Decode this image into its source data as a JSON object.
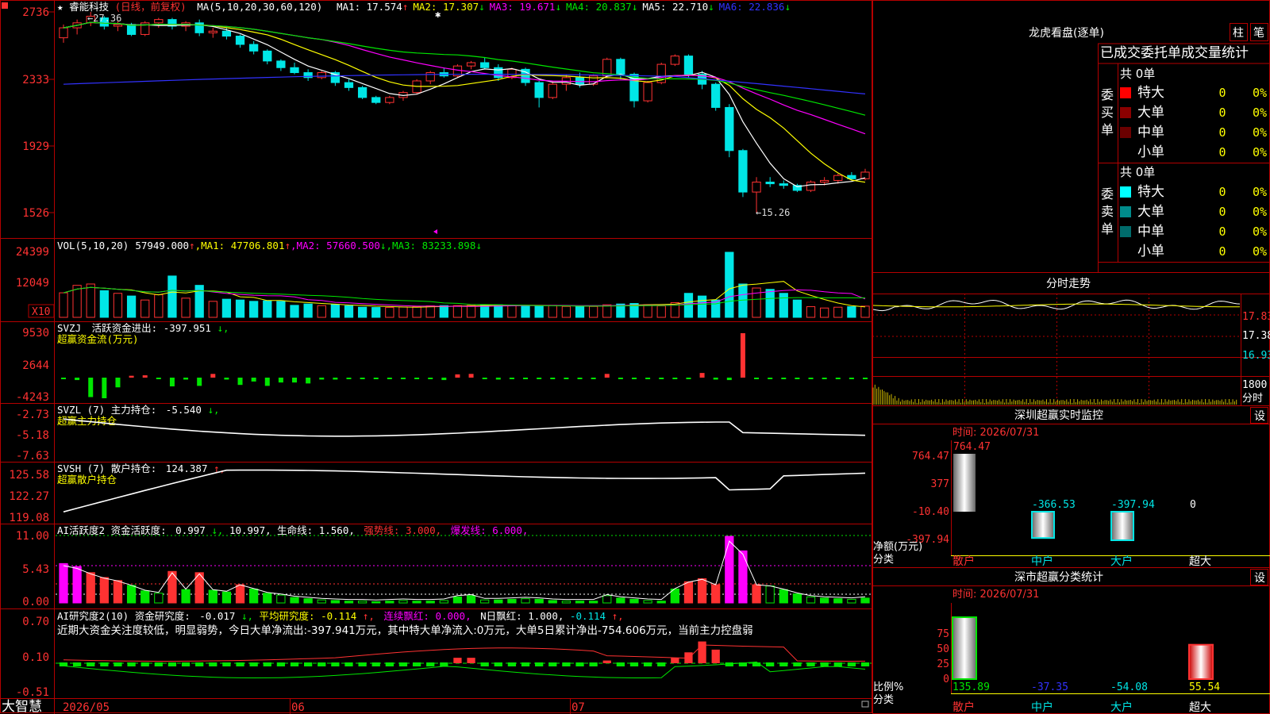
{
  "colors": {
    "up": "#ff3232",
    "down": "#00e6e6",
    "green_bar": "#00e600",
    "grid_red": "#b40000",
    "ma1": "#ffffff",
    "ma2": "#ffff00",
    "ma3": "#ff00ff",
    "ma4": "#00e600",
    "ma5": "#3232ff"
  },
  "top_corner_icon": "menu-square-icon",
  "stock": {
    "star": "★",
    "name": "睿能科技",
    "period": "(日线，前复权)",
    "ma_title": "MA(5,10,20,30,60,120)",
    "ma": [
      {
        "label": "MA1:",
        "value": "17.574",
        "arrow": "↑",
        "color": "#ffffff"
      },
      {
        "label": "MA2:",
        "value": "17.307",
        "arrow": "↓",
        "color": "#ffff00"
      },
      {
        "label": "MA3:",
        "value": "19.671",
        "arrow": "↓",
        "color": "#ff00ff"
      },
      {
        "label": "MA4:",
        "value": "20.837",
        "arrow": "↓",
        "color": "#00e600"
      },
      {
        "label": "MA5:",
        "value": "22.710",
        "arrow": "↓",
        "color": "#ffffff"
      },
      {
        "label": "MA6:",
        "value": "22.836",
        "arrow": "↓",
        "color": "#3232ff"
      }
    ],
    "high_label": "27.36",
    "low_label": "15.26",
    "y_ticks": [
      "2736",
      "2333",
      "1929",
      "1526"
    ]
  },
  "volume": {
    "title": "VOL(5,10,20)",
    "value": "57949.000",
    "arrow": "↑",
    "ma": [
      {
        "label": "MA1:",
        "value": "47706.801",
        "arrow": "↑",
        "color": "#ffff00"
      },
      {
        "label": "MA2:",
        "value": "57660.500",
        "arrow": "↓",
        "color": "#ff00ff"
      },
      {
        "label": "MA3:",
        "value": "83233.898",
        "arrow": "↓",
        "color": "#00e600"
      }
    ],
    "y_ticks": [
      "24399",
      "12049"
    ],
    "unit": "X10"
  },
  "svzj": {
    "title": "SVZJ",
    "label": "活跃资金进出:",
    "value": "-397.951",
    "arrow": "↓,",
    "subtitle": "超赢资金流(万元)",
    "y_ticks": [
      "9530",
      "2644",
      "-4243"
    ]
  },
  "svzl": {
    "title": "SVZL (7) 主力持仓:",
    "value": "-5.540",
    "arrow": "↓,",
    "subtitle": "超赢主力持仓",
    "y_ticks": [
      "-2.73",
      "-5.18",
      "-7.63"
    ]
  },
  "svsh": {
    "title": "SVSH (7) 散户持仓:",
    "value": "124.387",
    "arrow": "↑,",
    "subtitle": "超赢散户持仓",
    "y_ticks": [
      "125.58",
      "122.27",
      "119.08"
    ]
  },
  "ai_active": {
    "title": "AI活跃度2 资金活跃度:",
    "value": "0.997",
    "arrow": "↓,",
    "v2": "10.997,",
    "life_label": "生命线:",
    "life_value": "1.560,",
    "strong_label": "强势线:",
    "strong_value": "3.000,",
    "burst_label": "爆发线:",
    "burst_value": "6.000,",
    "y_ticks": [
      "11.00",
      "5.43",
      "0.00"
    ]
  },
  "ai_research": {
    "title": "AI研究度2(10) 资金研究度:",
    "value": "-0.017",
    "arrow": "↓,",
    "avg_label": "平均研究度:",
    "avg_value": "-0.114",
    "avg_arrow": "↑,",
    "red_label": "连续飘红:",
    "red_value": "0.000,",
    "n_label": "N日飘红:",
    "n_value": "1.000,",
    "last_value": "-0.114",
    "last_arrow": "↑,",
    "comment": "近期大资金关注度较低，明显弱势，今日大单净流出:-397.941万元，其中特大单净流入:0万元，大单5日累计净出-754.606万元，当前主力控盘弱",
    "y_ticks": [
      "0.70",
      "0.10",
      "-0.51"
    ]
  },
  "x_axis": [
    "2026/05",
    "06",
    "07"
  ],
  "brand": "大智慧",
  "dragon_panel": {
    "title": "龙虎看盘(逐单)",
    "btn_bar": "柱",
    "btn_pen": "笔",
    "tabs": [
      "已成交",
      "委托单",
      "成交量统计"
    ],
    "buy_label": "委买单",
    "sell_label": "委卖单",
    "buy_total": "共 0单",
    "sell_total": "共 0单",
    "buy_rows": [
      {
        "name": "特大",
        "count": "0",
        "pct": "0%",
        "color": "#ff0000"
      },
      {
        "name": "大单",
        "count": "0",
        "pct": "0%",
        "color": "#8b0000"
      },
      {
        "name": "中单",
        "count": "0",
        "pct": "0%",
        "color": "#6b0000"
      },
      {
        "name": "小单",
        "count": "0",
        "pct": "0%",
        "color": ""
      }
    ],
    "sell_rows": [
      {
        "name": "特大",
        "count": "0",
        "pct": "0%",
        "color": "#00ffff"
      },
      {
        "name": "大单",
        "count": "0",
        "pct": "0%",
        "color": "#008b8b"
      },
      {
        "name": "中单",
        "count": "0",
        "pct": "0%",
        "color": "#006b6b"
      },
      {
        "name": "小单",
        "count": "0",
        "pct": "0%",
        "color": ""
      }
    ]
  },
  "intraday": {
    "title": "分时走势",
    "prices": [
      "17.83",
      "17.38",
      "16.93"
    ],
    "vol_label": "1800",
    "time_label": "分时"
  },
  "monitor": {
    "title": "深圳超赢实时监控",
    "settings": "设",
    "time": "时间: 2026/07/31",
    "y_ticks": [
      "764.47",
      "377",
      "-10.40",
      "-397.94"
    ],
    "y_label": "净额(万元)",
    "cat_label": "分类",
    "bars": [
      {
        "cat": "散户",
        "value": "764.47",
        "num": 764.47
      },
      {
        "cat": "中户",
        "value": "-366.53",
        "num": -366.53
      },
      {
        "cat": "大户",
        "value": "-397.94",
        "num": -397.94
      },
      {
        "cat": "超大",
        "value": "0",
        "num": 0
      }
    ]
  },
  "classify": {
    "title": "深市超赢分类统计",
    "settings": "设",
    "time": "时间: 2026/07/31",
    "y_ticks": [
      "75",
      "50",
      "25",
      "0"
    ],
    "y_label": "比例%",
    "cat_label": "分类",
    "bars": [
      {
        "cat": "散户",
        "value": "135.89",
        "num": 135.89
      },
      {
        "cat": "中户",
        "value": "-37.35",
        "num": -37.35
      },
      {
        "cat": "大户",
        "value": "-54.08",
        "num": -54.08
      },
      {
        "cat": "超大",
        "value": "55.54",
        "num": 55.54
      }
    ]
  },
  "candles": [
    [
      25.8,
      26.6,
      25.5,
      26.4
    ],
    [
      26.4,
      26.9,
      26.0,
      26.7
    ],
    [
      26.7,
      27.36,
      26.5,
      27.1
    ],
    [
      27.0,
      27.1,
      26.3,
      26.5
    ],
    [
      26.5,
      26.8,
      26.2,
      26.6
    ],
    [
      26.6,
      26.7,
      25.9,
      26.0
    ],
    [
      26.0,
      26.8,
      25.9,
      26.7
    ],
    [
      26.7,
      27.0,
      26.4,
      26.9
    ],
    [
      26.9,
      27.0,
      26.3,
      26.5
    ],
    [
      26.5,
      26.8,
      26.2,
      26.7
    ],
    [
      26.7,
      26.9,
      25.9,
      26.1
    ],
    [
      26.1,
      26.4,
      25.8,
      26.2
    ],
    [
      26.2,
      26.4,
      25.7,
      25.9
    ],
    [
      25.9,
      26.0,
      25.2,
      25.4
    ],
    [
      25.4,
      25.6,
      24.8,
      25.0
    ],
    [
      25.0,
      25.1,
      24.2,
      24.4
    ],
    [
      24.4,
      24.5,
      23.8,
      24.0
    ],
    [
      24.0,
      24.3,
      23.6,
      23.7
    ],
    [
      23.7,
      23.9,
      23.2,
      23.4
    ],
    [
      23.4,
      23.8,
      23.3,
      23.7
    ],
    [
      23.7,
      23.8,
      22.9,
      23.1
    ],
    [
      23.1,
      23.3,
      22.6,
      22.8
    ],
    [
      22.8,
      22.9,
      22.1,
      22.2
    ],
    [
      22.2,
      22.3,
      21.8,
      21.9
    ],
    [
      21.9,
      22.3,
      21.8,
      22.2
    ],
    [
      22.2,
      22.6,
      22.0,
      22.5
    ],
    [
      22.5,
      23.3,
      22.4,
      23.2
    ],
    [
      23.2,
      23.8,
      23.0,
      23.7
    ],
    [
      23.7,
      24.0,
      23.4,
      23.5
    ],
    [
      23.5,
      24.2,
      23.4,
      24.1
    ],
    [
      24.1,
      24.4,
      23.9,
      24.3
    ],
    [
      24.3,
      24.6,
      23.9,
      24.0
    ],
    [
      24.0,
      24.2,
      23.2,
      23.4
    ],
    [
      23.4,
      24.0,
      23.3,
      23.9
    ],
    [
      23.9,
      24.0,
      22.9,
      23.1
    ],
    [
      23.1,
      23.2,
      21.6,
      22.2
    ],
    [
      22.2,
      23.2,
      22.1,
      23.0
    ],
    [
      23.0,
      23.6,
      22.6,
      23.4
    ],
    [
      23.4,
      23.7,
      22.8,
      23.0
    ],
    [
      23.0,
      23.6,
      22.9,
      23.5
    ],
    [
      23.5,
      24.6,
      23.4,
      24.5
    ],
    [
      24.5,
      24.6,
      23.3,
      23.6
    ],
    [
      23.6,
      23.7,
      21.6,
      22.0
    ],
    [
      22.0,
      23.2,
      21.9,
      23.1
    ],
    [
      23.1,
      24.3,
      23.0,
      24.2
    ],
    [
      24.2,
      24.8,
      24.1,
      24.7
    ],
    [
      24.7,
      24.8,
      23.4,
      23.6
    ],
    [
      23.6,
      23.8,
      22.7,
      23.0
    ],
    [
      23.0,
      23.1,
      21.4,
      21.6
    ],
    [
      21.6,
      21.8,
      18.6,
      19.0
    ],
    [
      19.0,
      19.1,
      16.2,
      16.5
    ],
    [
      16.5,
      17.4,
      15.26,
      17.1
    ],
    [
      17.1,
      17.4,
      16.8,
      17.0
    ],
    [
      17.0,
      17.2,
      16.7,
      16.9
    ],
    [
      16.9,
      17.0,
      16.5,
      16.6
    ],
    [
      16.6,
      17.2,
      16.5,
      17.1
    ],
    [
      17.1,
      17.4,
      16.9,
      17.2
    ],
    [
      17.2,
      17.6,
      17.0,
      17.5
    ],
    [
      17.5,
      17.7,
      17.2,
      17.3
    ],
    [
      17.3,
      17.9,
      17.2,
      17.7
    ]
  ],
  "volumes": [
    9200,
    12000,
    12500,
    10000,
    9000,
    8000,
    6500,
    8500,
    15500,
    7200,
    12000,
    6000,
    6800,
    6500,
    6000,
    6200,
    6000,
    4500,
    5000,
    4400,
    4800,
    4300,
    3800,
    3700,
    3700,
    3900,
    4000,
    4300,
    4400,
    4400,
    4500,
    4700,
    4700,
    4400,
    4300,
    4400,
    4500,
    4100,
    4000,
    4100,
    4700,
    5000,
    5200,
    4700,
    4300,
    5500,
    9000,
    8000,
    6500,
    24399,
    12500,
    11000,
    10500,
    9000,
    6500,
    4000,
    3500,
    3800,
    4000,
    4200
  ],
  "svzj_vals": [
    -300,
    -500,
    -4000,
    -4243,
    -2000,
    400,
    500,
    -200,
    -1800,
    -400,
    -1700,
    800,
    -400,
    -1500,
    -800,
    -1700,
    -1000,
    -1000,
    -1200,
    -400,
    -400,
    -200,
    -100,
    -300,
    -200,
    -100,
    -300,
    -200,
    -500,
    700,
    800,
    -300,
    -400,
    -200,
    -300,
    -300,
    -200,
    -100,
    -100,
    -100,
    800,
    -200,
    -200,
    -150,
    -300,
    -200,
    -200,
    1000,
    -400,
    -500,
    9530,
    -300,
    -200,
    -100,
    -100,
    -100,
    -200,
    -200,
    -100,
    -300
  ],
  "act_vals": [
    6.5,
    6.0,
    5.0,
    4.2,
    3.7,
    2.9,
    2.0,
    1.6,
    5.2,
    2.2,
    5.0,
    2.1,
    1.8,
    3.0,
    2.3,
    1.6,
    1.3,
    0.9,
    0.7,
    0.5,
    0.4,
    0.3,
    0.3,
    0.2,
    0.3,
    0.4,
    0.3,
    0.3,
    0.4,
    1.0,
    1.2,
    0.5,
    0.5,
    0.6,
    0.7,
    0.6,
    0.4,
    0.3,
    0.3,
    0.3,
    1.2,
    0.8,
    0.6,
    0.4,
    0.3,
    2.3,
    3.5,
    4.0,
    3.0,
    10.997,
    8.6,
    3.0,
    2.8,
    2.2,
    1.5,
    1.0,
    0.8,
    0.7,
    0.6,
    0.8
  ],
  "res_vals": [
    0,
    0,
    0,
    0,
    0,
    0,
    0,
    0,
    0,
    0,
    0,
    0,
    0,
    0,
    0,
    0,
    0,
    0,
    0,
    0,
    0,
    0,
    0,
    0,
    0,
    0,
    0,
    0,
    0,
    0.1,
    0.1,
    0,
    0,
    0,
    0,
    0,
    0,
    0,
    0,
    0,
    0.05,
    0,
    0,
    0,
    0,
    0.1,
    0.2,
    0.4,
    0.25,
    0.0,
    0,
    0,
    0,
    0,
    0,
    0,
    0,
    0,
    0,
    0
  ]
}
